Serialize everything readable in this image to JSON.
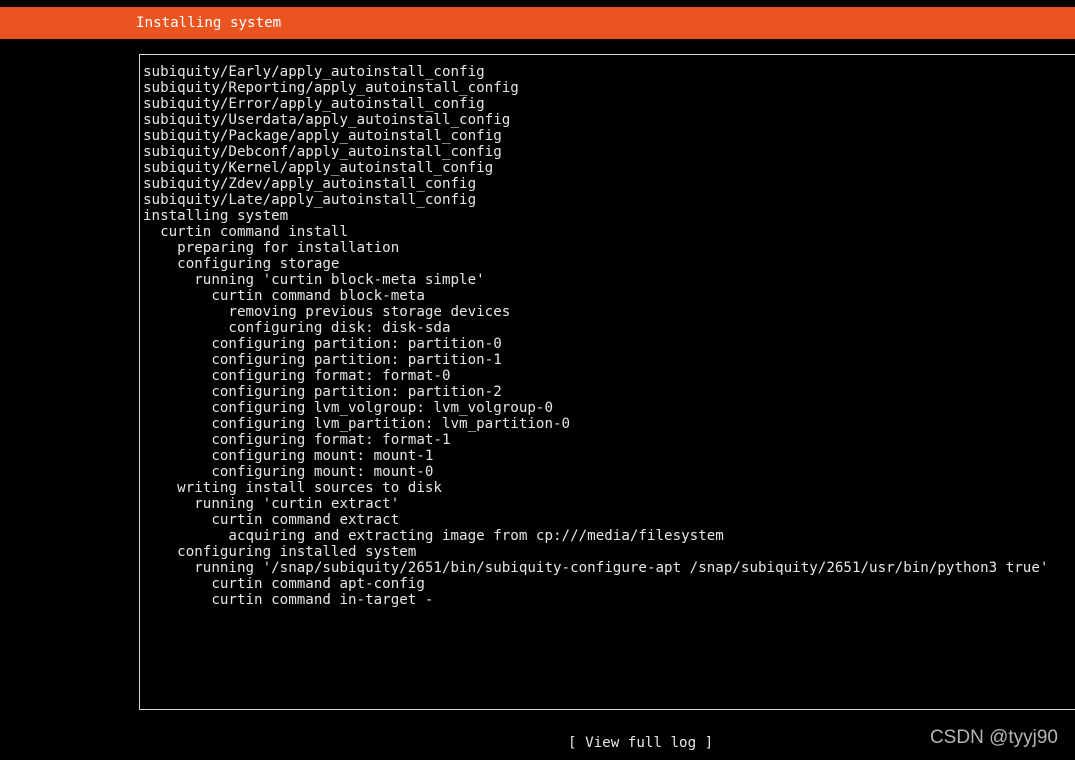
{
  "header": {
    "title": "Installing system"
  },
  "log": {
    "lines": [
      "subiquity/Early/apply_autoinstall_config",
      "subiquity/Reporting/apply_autoinstall_config",
      "subiquity/Error/apply_autoinstall_config",
      "subiquity/Userdata/apply_autoinstall_config",
      "subiquity/Package/apply_autoinstall_config",
      "subiquity/Debconf/apply_autoinstall_config",
      "subiquity/Kernel/apply_autoinstall_config",
      "subiquity/Zdev/apply_autoinstall_config",
      "subiquity/Late/apply_autoinstall_config",
      "installing system",
      "  curtin command install",
      "    preparing for installation",
      "    configuring storage",
      "      running 'curtin block-meta simple'",
      "        curtin command block-meta",
      "          removing previous storage devices",
      "          configuring disk: disk-sda",
      "        configuring partition: partition-0",
      "        configuring partition: partition-1",
      "        configuring format: format-0",
      "        configuring partition: partition-2",
      "        configuring lvm_volgroup: lvm_volgroup-0",
      "        configuring lvm_partition: lvm_partition-0",
      "        configuring format: format-1",
      "        configuring mount: mount-1",
      "        configuring mount: mount-0",
      "    writing install sources to disk",
      "      running 'curtin extract'",
      "        curtin command extract",
      "          acquiring and extracting image from cp:///media/filesystem",
      "    configuring installed system",
      "      running '/snap/subiquity/2651/bin/subiquity-configure-apt /snap/subiquity/2651/usr/bin/python3 true'",
      "        curtin command apt-config",
      "        curtin command in-target -"
    ]
  },
  "footer": {
    "view_log_label": "[ View full log ]"
  },
  "watermark": {
    "text": "CSDN @tyyj90"
  },
  "colors": {
    "header_bar": "#e95420",
    "background": "#000000",
    "text": "#e6e6e6"
  }
}
